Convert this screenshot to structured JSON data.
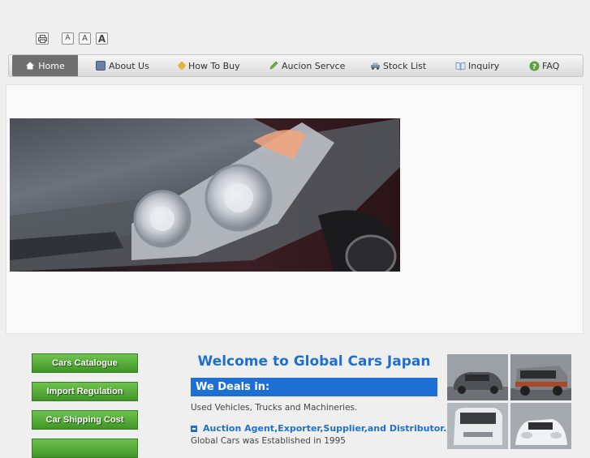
{
  "toolbar": {
    "font_small": "A",
    "font_medium": "A",
    "font_large": "A"
  },
  "nav": {
    "items": [
      {
        "label": "Home",
        "icon": "home-icon"
      },
      {
        "label": "About Us",
        "icon": "about-icon"
      },
      {
        "label": "How To Buy",
        "icon": "tag-icon"
      },
      {
        "label": "Aucion Servce",
        "icon": "pen-icon"
      },
      {
        "label": "Stock List",
        "icon": "car-icon"
      },
      {
        "label": "Inquiry",
        "icon": "book-icon"
      },
      {
        "label": "FAQ",
        "icon": "question-icon"
      }
    ]
  },
  "sidebar": {
    "buttons": [
      {
        "label": "Cars Catalogue"
      },
      {
        "label": "Import Regulation"
      },
      {
        "label": "Car Shipping Cost"
      }
    ]
  },
  "main": {
    "welcome_title": "Welcome to Global Cars Japan",
    "deals_heading": "We Deals in:",
    "deals_text": "Used Vehicles, Trucks and Machineries.",
    "service_line": "Auction Agent,Exporter,Supplier,and Distributor.",
    "established": "Global Cars was Established in 1995"
  },
  "colors": {
    "accent_blue": "#1e6fd4",
    "button_green": "#4ea834",
    "nav_active": "#6f6f6f"
  }
}
